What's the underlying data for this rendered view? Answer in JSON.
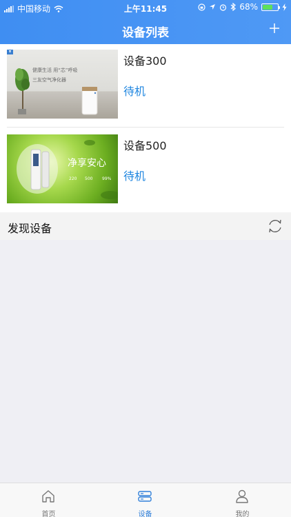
{
  "status_bar": {
    "carrier": "中国移动",
    "time": "上午11:45",
    "battery_percent": "68%",
    "battery_level": 0.68
  },
  "nav": {
    "title": "设备列表",
    "add_icon": "plus-icon"
  },
  "devices": [
    {
      "name": "设备300",
      "status": "待机",
      "image_text": [
        "健康生活 用“芯”呼吸",
        "三友空气净化器"
      ]
    },
    {
      "name": "设备500",
      "status": "待机",
      "image_text": [
        "净享安心",
        "220",
        "500",
        "99%"
      ]
    }
  ],
  "discover": {
    "title": "发现设备",
    "refresh_icon": "refresh-icon"
  },
  "tabbar": {
    "items": [
      {
        "label": "首页",
        "icon": "home-icon",
        "active": false
      },
      {
        "label": "设备",
        "icon": "device-icon",
        "active": true
      },
      {
        "label": "我的",
        "icon": "person-icon",
        "active": false
      }
    ]
  },
  "colors": {
    "header": "#4a95f4",
    "accent": "#1f86e0",
    "tab_active": "#2f7fd9"
  }
}
